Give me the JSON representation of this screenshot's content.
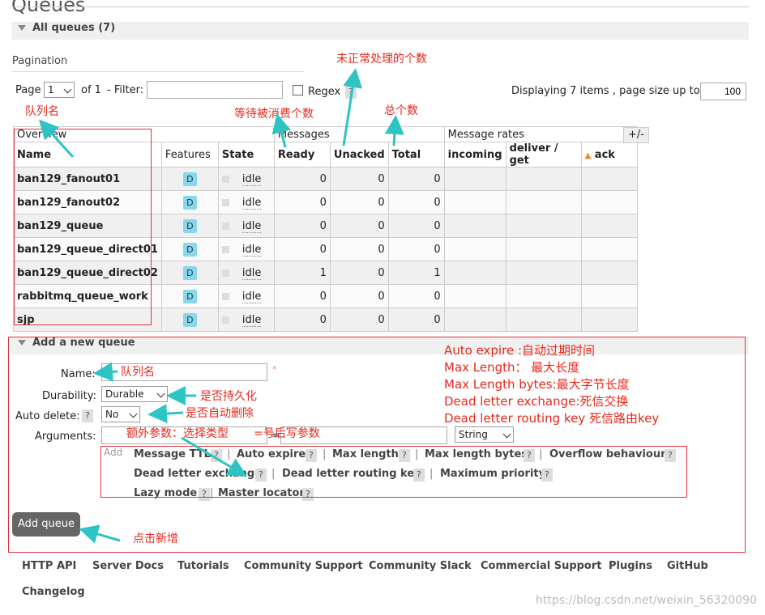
{
  "page": {
    "title": "Queues"
  },
  "all_queues": {
    "label": "All queues (7)"
  },
  "pagination": {
    "label": "Pagination",
    "page_label": "Page",
    "page_value": "1",
    "of_label": "of 1",
    "filter_label": "- Filter:",
    "filter_value": "",
    "regex_label": "Regex",
    "help": "?",
    "displaying": "Displaying 7 items , page size up to:",
    "page_size": "100"
  },
  "table": {
    "groups": {
      "overview": "Overview",
      "messages": "Messages",
      "rates": "Message rates"
    },
    "plus_minus": "+/-",
    "headers": {
      "name": "Name",
      "features": "Features",
      "state": "State",
      "ready": "Ready",
      "unacked": "Unacked",
      "total": "Total",
      "incoming": "incoming",
      "deliver": "deliver / get",
      "ack": "ack"
    },
    "rows": [
      {
        "name": "ban129_fanout01",
        "feature": "D",
        "state": "idle",
        "ready": "0",
        "unacked": "0",
        "total": "0"
      },
      {
        "name": "ban129_fanout02",
        "feature": "D",
        "state": "idle",
        "ready": "0",
        "unacked": "0",
        "total": "0"
      },
      {
        "name": "ban129_queue",
        "feature": "D",
        "state": "idle",
        "ready": "0",
        "unacked": "0",
        "total": "0"
      },
      {
        "name": "ban129_queue_direct01",
        "feature": "D",
        "state": "idle",
        "ready": "0",
        "unacked": "0",
        "total": "0"
      },
      {
        "name": "ban129_queue_direct02",
        "feature": "D",
        "state": "idle",
        "ready": "1",
        "unacked": "0",
        "total": "1"
      },
      {
        "name": "rabbitmq_queue_work",
        "feature": "D",
        "state": "idle",
        "ready": "0",
        "unacked": "0",
        "total": "0"
      },
      {
        "name": "sjp",
        "feature": "D",
        "state": "idle",
        "ready": "0",
        "unacked": "0",
        "total": "0"
      }
    ]
  },
  "add_queue": {
    "title": "Add a new queue",
    "name_label": "Name:",
    "name_value": "",
    "required_mark": "*",
    "durability_label": "Durability:",
    "durability_value": "Durable",
    "auto_delete_label": "Auto delete:",
    "auto_delete_help": "?",
    "auto_delete_value": "No",
    "arguments_label": "Arguments:",
    "arg_key": "",
    "arg_eq": "=",
    "arg_value": "",
    "arg_type": "String",
    "add_label": "Add",
    "arguments": [
      "Message TTL",
      "Auto expire",
      "Max length",
      "Max length bytes",
      "Overflow behaviour",
      "Dead letter exchange",
      "Dead letter routing key",
      "Maximum priority",
      "Lazy mode",
      "Master locator"
    ],
    "help": "?",
    "sep": "|",
    "button": "Add queue"
  },
  "annotations": {
    "unprocessed": "未正常处理的个数",
    "queue_name": "队列名",
    "waiting": "等待被消费个数",
    "total": "总个数",
    "name_field": "队列名",
    "durable": "是否持久化",
    "auto_delete": "是否自动删除",
    "extra_args": "额外参数：选择类型",
    "after_eq": "=号后写参数",
    "click_add": "点击新增",
    "legend": [
      "Auto expire :自动过期时间",
      "Max Length：  最大长度",
      "Max Length bytes:最大字节长度",
      "Dead letter exchange:死信交换",
      "Dead letter routing key 死信路由key"
    ]
  },
  "footer": {
    "links": [
      "HTTP API",
      "Server Docs",
      "Tutorials",
      "Community Support",
      "Community Slack",
      "Commercial Support",
      "Plugins",
      "GitHub",
      "Changelog"
    ]
  },
  "watermark": "https://blog.csdn.net/weixin_56320090",
  "colors": {
    "annotation_red": "#e8271c",
    "arrow_cyan": "#2ec4c4",
    "badge": "#86d8ec",
    "ack_triangle": "#f0861e"
  }
}
